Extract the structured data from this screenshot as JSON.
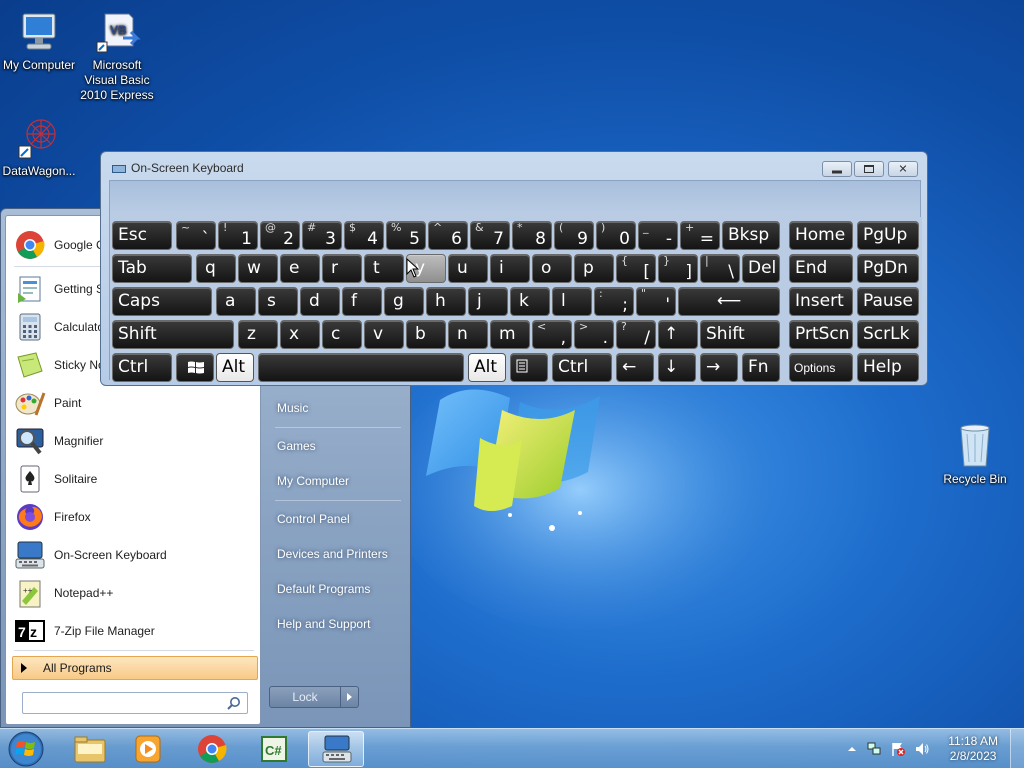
{
  "desktop": {
    "icons": [
      {
        "name": "my-computer",
        "label": "My Computer"
      },
      {
        "name": "vb-express",
        "label": "Microsoft Visual Basic 2010 Express"
      },
      {
        "name": "datawagon",
        "label": "DataWagon..."
      },
      {
        "name": "recycle-bin",
        "label": "Recycle Bin"
      }
    ]
  },
  "start_menu": {
    "programs": [
      {
        "label": "Google C",
        "icon": "chrome-icon"
      },
      {
        "label": "Getting S",
        "icon": "getting-started-icon"
      },
      {
        "label": "Calculato",
        "icon": "calculator-icon"
      },
      {
        "label": "Sticky No",
        "icon": "sticky-notes-icon"
      },
      {
        "label": "Paint",
        "icon": "paint-icon"
      },
      {
        "label": "Magnifier",
        "icon": "magnifier-icon"
      },
      {
        "label": "Solitaire",
        "icon": "solitaire-icon"
      },
      {
        "label": "Firefox",
        "icon": "firefox-icon"
      },
      {
        "label": "On-Screen Keyboard",
        "icon": "keyboard-icon"
      },
      {
        "label": "Notepad++",
        "icon": "notepad-plus-icon"
      },
      {
        "label": "7-Zip File Manager",
        "icon": "7zip-icon"
      }
    ],
    "all_programs": "All Programs",
    "search_placeholder": "",
    "right_items": [
      {
        "label": "Music"
      },
      {
        "label": "Games"
      },
      {
        "label": "My Computer"
      },
      {
        "label": "Control Panel"
      },
      {
        "label": "Devices and Printers"
      },
      {
        "label": "Default Programs"
      },
      {
        "label": "Help and Support"
      }
    ],
    "lock_label": "Lock"
  },
  "osk": {
    "title": "On-Screen Keyboard",
    "rows": [
      [
        {
          "t": "lab",
          "label": "Esc"
        },
        {
          "t": "dual",
          "shift": "~",
          "char": "`"
        },
        {
          "t": "dual",
          "shift": "!",
          "char": "1"
        },
        {
          "t": "dual",
          "shift": "@",
          "char": "2"
        },
        {
          "t": "dual",
          "shift": "#",
          "char": "3"
        },
        {
          "t": "dual",
          "shift": "$",
          "char": "4"
        },
        {
          "t": "dual",
          "shift": "%",
          "char": "5"
        },
        {
          "t": "dual",
          "shift": "^",
          "char": "6"
        },
        {
          "t": "dual",
          "shift": "&",
          "char": "7"
        },
        {
          "t": "dual",
          "shift": "*",
          "char": "8"
        },
        {
          "t": "dual",
          "shift": "(",
          "char": "9"
        },
        {
          "t": "dual",
          "shift": ")",
          "char": "0"
        },
        {
          "t": "dual",
          "shift": "_",
          "char": "-"
        },
        {
          "t": "dual",
          "shift": "+",
          "char": "="
        },
        {
          "t": "lab",
          "label": "Bksp"
        },
        {
          "t": "lab",
          "label": "Home"
        },
        {
          "t": "lab",
          "label": "PgUp"
        }
      ],
      [
        {
          "t": "lab",
          "label": "Tab"
        },
        {
          "t": "let",
          "label": "q"
        },
        {
          "t": "let",
          "label": "w"
        },
        {
          "t": "let",
          "label": "e"
        },
        {
          "t": "let",
          "label": "r"
        },
        {
          "t": "let",
          "label": "t"
        },
        {
          "t": "let",
          "label": "y"
        },
        {
          "t": "let",
          "label": "u"
        },
        {
          "t": "let",
          "label": "i"
        },
        {
          "t": "let",
          "label": "o"
        },
        {
          "t": "let",
          "label": "p"
        },
        {
          "t": "dual",
          "shift": "{",
          "char": "["
        },
        {
          "t": "dual",
          "shift": "}",
          "char": "]"
        },
        {
          "t": "dual",
          "shift": "|",
          "char": "\\"
        },
        {
          "t": "lab",
          "label": "Del"
        },
        {
          "t": "lab",
          "label": "End"
        },
        {
          "t": "lab",
          "label": "PgDn"
        }
      ],
      [
        {
          "t": "lab",
          "label": "Caps"
        },
        {
          "t": "let",
          "label": "a"
        },
        {
          "t": "let",
          "label": "s"
        },
        {
          "t": "let",
          "label": "d"
        },
        {
          "t": "let",
          "label": "f"
        },
        {
          "t": "let",
          "label": "g"
        },
        {
          "t": "let",
          "label": "h"
        },
        {
          "t": "let",
          "label": "j"
        },
        {
          "t": "let",
          "label": "k"
        },
        {
          "t": "let",
          "label": "l"
        },
        {
          "t": "dual",
          "shift": ":",
          "char": ";"
        },
        {
          "t": "dual",
          "shift": "\"",
          "char": "'"
        },
        {
          "t": "lab",
          "label": "⟵"
        },
        {
          "t": "lab",
          "label": "Insert"
        },
        {
          "t": "lab",
          "label": "Pause"
        }
      ],
      [
        {
          "t": "lab",
          "label": "Shift"
        },
        {
          "t": "let",
          "label": "z"
        },
        {
          "t": "let",
          "label": "x"
        },
        {
          "t": "let",
          "label": "c"
        },
        {
          "t": "let",
          "label": "v"
        },
        {
          "t": "let",
          "label": "b"
        },
        {
          "t": "let",
          "label": "n"
        },
        {
          "t": "let",
          "label": "m"
        },
        {
          "t": "dual",
          "shift": "<",
          "char": ","
        },
        {
          "t": "dual",
          "shift": ">",
          "char": "."
        },
        {
          "t": "dual",
          "shift": "?",
          "char": "/"
        },
        {
          "t": "lab",
          "label": "↑"
        },
        {
          "t": "lab",
          "label": "Shift"
        },
        {
          "t": "lab",
          "label": "PrtScn"
        },
        {
          "t": "lab",
          "label": "ScrLk"
        }
      ],
      [
        {
          "t": "lab",
          "label": "Ctrl"
        },
        {
          "t": "icon",
          "label": ""
        },
        {
          "t": "lab",
          "label": "Alt"
        },
        {
          "t": "lab",
          "label": ""
        },
        {
          "t": "lab",
          "label": "Alt"
        },
        {
          "t": "icon",
          "label": ""
        },
        {
          "t": "lab",
          "label": "Ctrl"
        },
        {
          "t": "lab",
          "label": "←"
        },
        {
          "t": "lab",
          "label": "↓"
        },
        {
          "t": "lab",
          "label": "→"
        },
        {
          "t": "lab",
          "label": "Fn"
        },
        {
          "t": "lab",
          "label": "Options"
        },
        {
          "t": "lab",
          "label": "Help"
        }
      ]
    ]
  },
  "taskbar": {
    "buttons": [
      {
        "name": "explorer-icon"
      },
      {
        "name": "media-player-icon"
      },
      {
        "name": "chrome-icon"
      },
      {
        "name": "csharp-express-icon"
      },
      {
        "name": "osk-taskbar-icon",
        "active": true
      }
    ],
    "time": "11:18 AM",
    "date": "2/8/2023"
  }
}
